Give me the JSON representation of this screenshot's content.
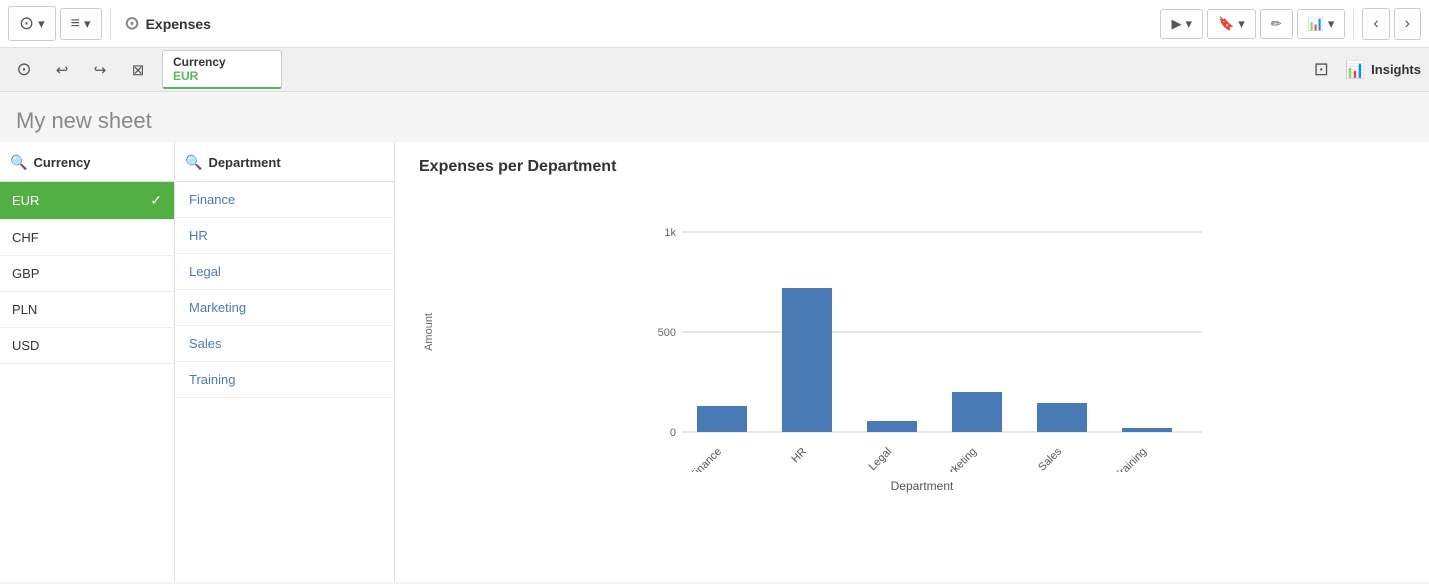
{
  "toolbar": {
    "app_icon": "⊙",
    "app_name": "Expenses",
    "list_icon": "≡",
    "present_btn": "▶",
    "bookmark_btn": "🔖",
    "edit_btn": "✏",
    "chart_btn": "📊",
    "back_btn": "‹",
    "forward_btn": "›"
  },
  "filter_bar": {
    "lasso_icon": "⊡",
    "back_selection_icon": "↩",
    "forward_selection_icon": "↪",
    "clear_icon": "⊠",
    "insights_icon": "📊",
    "insights_label": "Insights"
  },
  "filter_chip": {
    "label": "Currency",
    "value": "EUR"
  },
  "sheet": {
    "title": "My new sheet"
  },
  "currency_panel": {
    "header": "Currency",
    "items": [
      {
        "label": "EUR",
        "selected": true
      },
      {
        "label": "CHF",
        "selected": false
      },
      {
        "label": "GBP",
        "selected": false
      },
      {
        "label": "PLN",
        "selected": false
      },
      {
        "label": "USD",
        "selected": false
      }
    ]
  },
  "department_panel": {
    "header": "Department",
    "items": [
      {
        "label": "Finance"
      },
      {
        "label": "HR"
      },
      {
        "label": "Legal"
      },
      {
        "label": "Marketing"
      },
      {
        "label": "Sales"
      },
      {
        "label": "Training"
      }
    ]
  },
  "chart": {
    "title": "Expenses per Department",
    "y_axis_label": "Amount",
    "x_axis_label": "Department",
    "bars": [
      {
        "dept": "Finance",
        "value": 130,
        "max": 1000
      },
      {
        "dept": "HR",
        "value": 720,
        "max": 1000
      },
      {
        "dept": "Legal",
        "value": 55,
        "max": 1000
      },
      {
        "dept": "Marketing",
        "value": 200,
        "max": 1000
      },
      {
        "dept": "Sales",
        "value": 145,
        "max": 1000
      },
      {
        "dept": "Training",
        "value": 18,
        "max": 1000
      }
    ],
    "y_ticks": [
      "0",
      "500",
      "1k"
    ],
    "bar_color": "#4a7ab5"
  }
}
